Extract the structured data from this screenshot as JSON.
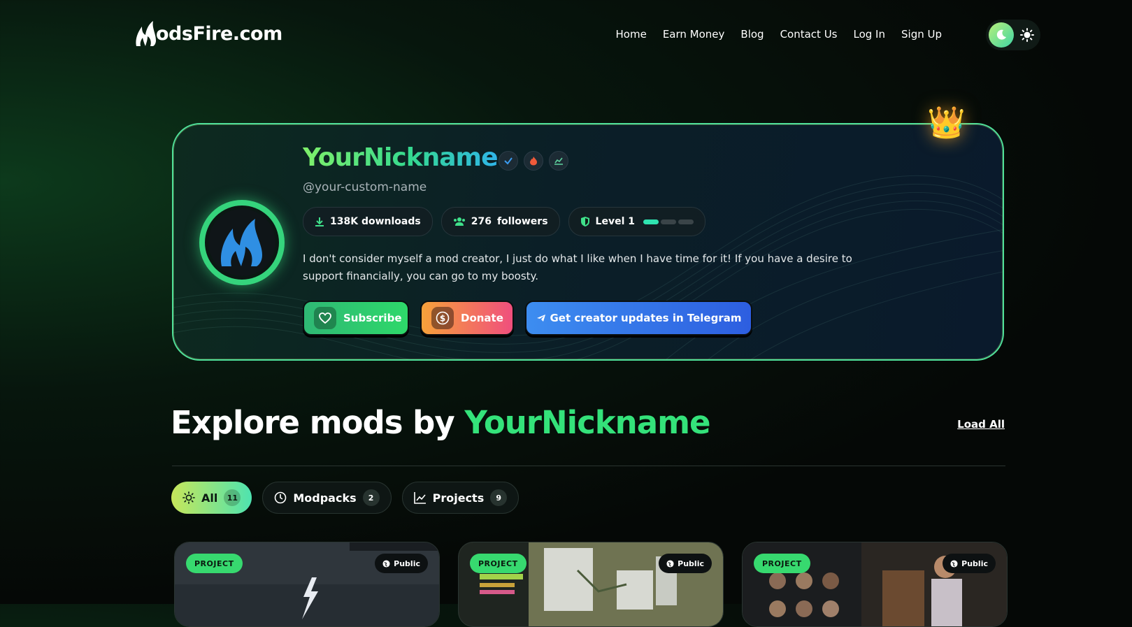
{
  "site": {
    "logo_text": "odsFire.com"
  },
  "nav": {
    "items": [
      "Home",
      "Earn Money",
      "Blog",
      "Contact Us",
      "Log In",
      "Sign Up"
    ]
  },
  "profile": {
    "nickname": "YourNickname",
    "handle": "@your-custom-name",
    "downloads": "138K downloads",
    "followers_count": "276",
    "followers_label": "followers",
    "level": "Level 1",
    "level_progress_segments_filled": 1,
    "level_progress_segments_total": 3,
    "bio": "I don't consider myself a mod creator, I just do what I like when I have time for it! If you have a desire to support financially, you can go to my boosty.",
    "subscribe_label": "Subscribe",
    "donate_label": "Donate",
    "telegram_label": "Get creator updates in Telegram"
  },
  "explore": {
    "title_prefix": "Explore mods by",
    "title_name": "YourNickname",
    "load_all": "Load All"
  },
  "filters": [
    {
      "label": "All",
      "count": "11",
      "icon": "sun-icon",
      "active": true
    },
    {
      "label": "Modpacks",
      "count": "2",
      "icon": "clock-icon",
      "active": false
    },
    {
      "label": "Projects",
      "count": "9",
      "icon": "chart-icon",
      "active": false
    }
  ],
  "mod_cards": [
    {
      "tag": "PROJECT",
      "visibility": "Public"
    },
    {
      "tag": "PROJECT",
      "visibility": "Public"
    },
    {
      "tag": "PROJECT",
      "visibility": "Public"
    }
  ],
  "colors": {
    "accent_green": "#34e27a",
    "telegram_blue": "#3d8df0",
    "donate_orange": "#f6a13a"
  }
}
